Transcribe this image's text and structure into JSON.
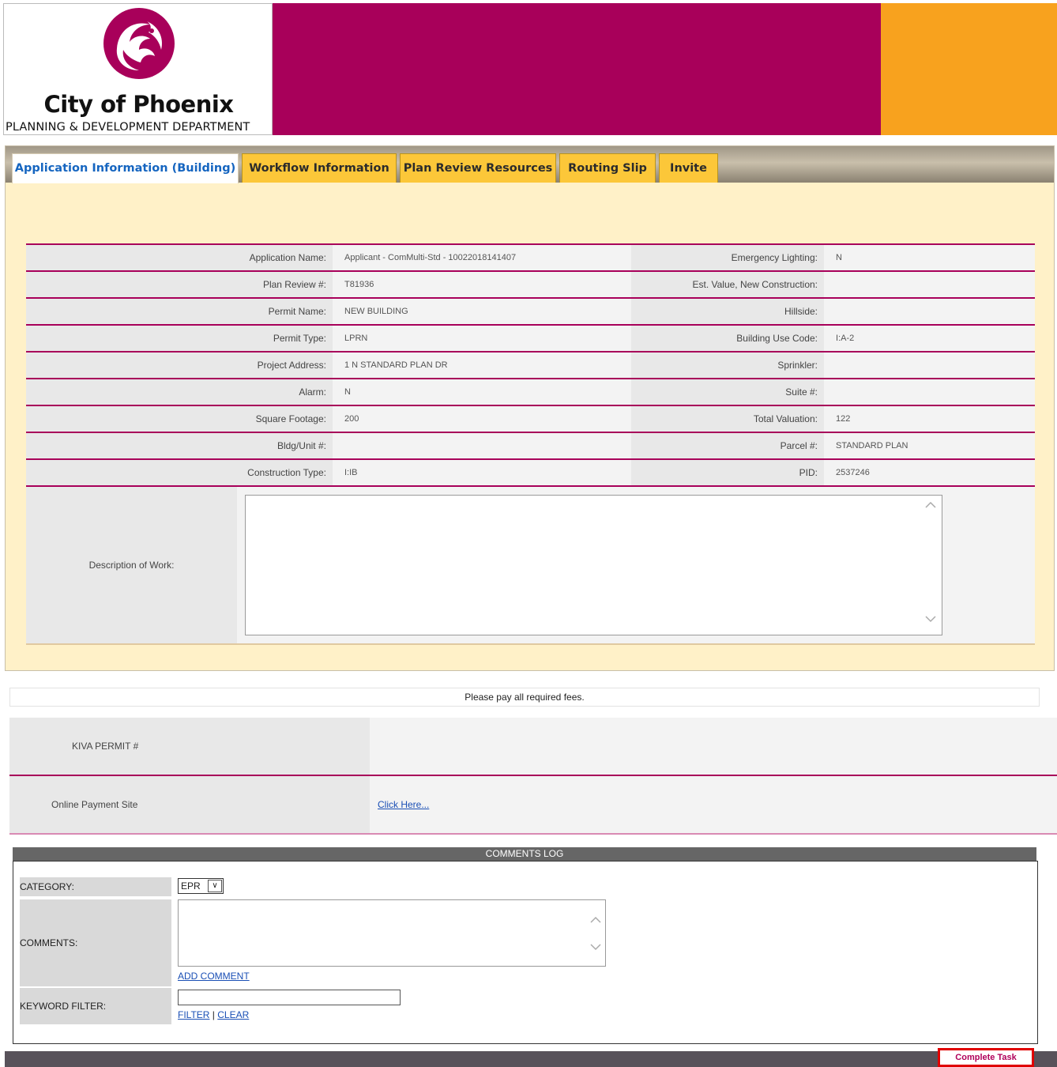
{
  "header": {
    "logo_title": "City of Phoenix",
    "logo_subtitle": "PLANNING & DEVELOPMENT DEPARTMENT",
    "colors": {
      "magenta": "#a8005a",
      "orange": "#f8a21e"
    }
  },
  "tabs": [
    {
      "label": "Application Information (Building)",
      "active": true
    },
    {
      "label": "Workflow Information"
    },
    {
      "label": "Plan Review Resources"
    },
    {
      "label": "Routing Slip"
    },
    {
      "label": "Invite"
    }
  ],
  "app_info": {
    "rows": [
      {
        "label1": "Application Name:",
        "value1": "Applicant - ComMulti-Std - 10022018141407",
        "label2": "Emergency Lighting:",
        "value2": "N"
      },
      {
        "label1": "Plan Review #:",
        "value1": "T81936",
        "label2": "Est. Value, New Construction:",
        "value2": ""
      },
      {
        "label1": "Permit Name:",
        "value1": "NEW BUILDING",
        "label2": "Hillside:",
        "value2": ""
      },
      {
        "label1": "Permit Type:",
        "value1": "LPRN",
        "label2": "Building Use Code:",
        "value2": "I:A-2"
      },
      {
        "label1": "Project Address:",
        "value1": "1 N STANDARD PLAN DR",
        "label2": "Sprinkler:",
        "value2": ""
      },
      {
        "label1": "Alarm:",
        "value1": "N",
        "label2": "Suite #:",
        "value2": ""
      },
      {
        "label1": "Square Footage:",
        "value1": "200",
        "label2": "Total Valuation:",
        "value2": "122"
      },
      {
        "label1": "Bldg/Unit #:",
        "value1": "",
        "label2": "Parcel #:",
        "value2": "STANDARD PLAN"
      },
      {
        "label1": "Construction Type:",
        "value1": "I:IB",
        "label2": "PID:",
        "value2": "2537246"
      }
    ],
    "description_label": "Description of Work:",
    "description_value": ""
  },
  "notice": "Please pay all required fees.",
  "payment": {
    "kiva_label": "KIVA PERMIT #",
    "kiva_value": "",
    "online_label": "Online Payment Site",
    "online_link": "Click Here..."
  },
  "comments_log": {
    "title": "COMMENTS LOG",
    "category_label": "CATEGORY:",
    "category_value": "EPR",
    "comments_label": "COMMENTS:",
    "add_comment": "ADD COMMENT",
    "keyword_label": "KEYWORD FILTER:",
    "filter": "FILTER",
    "separator": "|",
    "clear": "CLEAR"
  },
  "footer": {
    "complete_task": "Complete Task"
  }
}
